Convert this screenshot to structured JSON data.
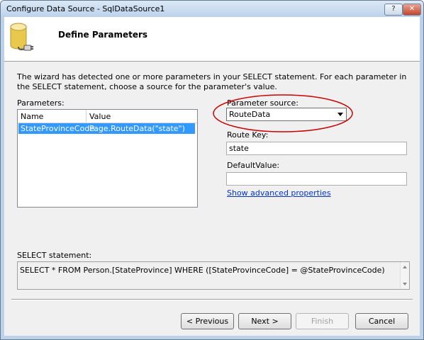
{
  "window": {
    "title": "Configure Data Source - SqlDataSource1",
    "help_label": "?",
    "close_label": "✕"
  },
  "header": {
    "title": "Define Parameters",
    "icon": "database-icon"
  },
  "description": "The wizard has detected one or more parameters in your SELECT statement. For each parameter in the SELECT statement, choose a source for the parameter's value.",
  "parameters": {
    "label": "Parameters:",
    "columns": [
      "Name",
      "Value"
    ],
    "rows": [
      {
        "name": "StateProvinceCode",
        "value": "Page.RouteData(\"state\")"
      }
    ]
  },
  "source": {
    "label": "Parameter source:",
    "value": "RouteData"
  },
  "route_key": {
    "label": "Route Key:",
    "value": "state"
  },
  "default_value": {
    "label": "DefaultValue:",
    "value": ""
  },
  "advanced_link": "Show advanced properties",
  "sql": {
    "label": "SELECT statement:",
    "text": "SELECT * FROM Person.[StateProvince] WHERE ([StateProvinceCode] = @StateProvinceCode)"
  },
  "buttons": {
    "previous": "< Previous",
    "next": "Next >",
    "finish": "Finish",
    "cancel": "Cancel"
  },
  "colors": {
    "highlight": "#3399ff",
    "annotation": "#cc0000",
    "link": "#0033cc"
  }
}
